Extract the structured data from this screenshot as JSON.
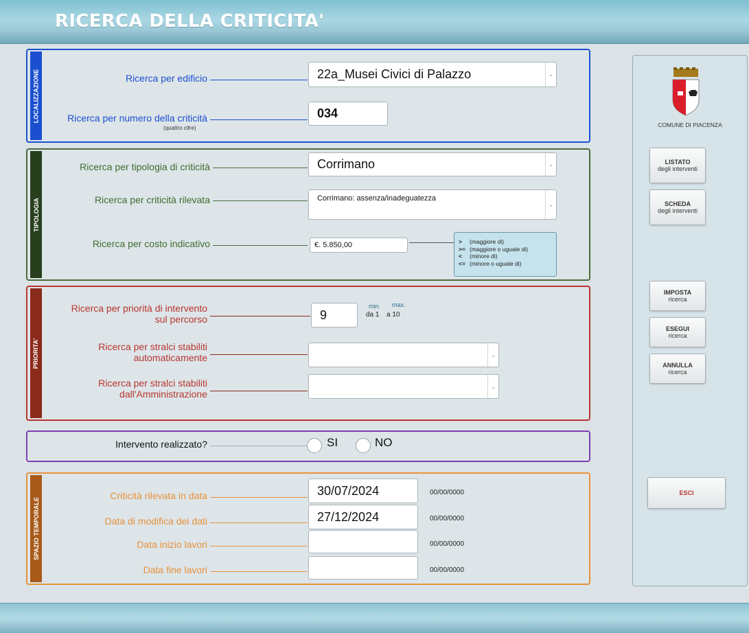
{
  "header": {
    "title": "RICERCA DELLA  CRITICITA'"
  },
  "colors": {
    "localizzazione": "#1b4fcf",
    "tipologia": "#4c6b3c",
    "priorita": "#b8352d",
    "intervento": "#7e3fb2",
    "spazio": "#e8913a"
  },
  "localizzazione": {
    "tab": "LOCALIZZAZIONE",
    "edificio_label": "Ricerca per edificio",
    "edificio_value": "22a_Musei Civici di Palazzo",
    "numero_label": "Ricerca per numero della criticità",
    "numero_sublabel": "(quattro cifre)",
    "numero_value": "034"
  },
  "tipologia": {
    "tab": "TIPOLOGIA",
    "tipologia_label": "Ricerca per tipologia di criticità",
    "tipologia_value": "Corrimano",
    "rilevata_label": "Ricerca per criticità rilevata",
    "rilevata_value": "Corrimano: assenza/inadeguatezza",
    "costo_label": "Ricerca per costo indicativo",
    "costo_value": "€.  5.850,00",
    "operators": [
      {
        "op": ">",
        "desc": "(maggiore di)"
      },
      {
        "op": ">=",
        "desc": "(maggiore o uguale di)"
      },
      {
        "op": "<",
        "desc": "(minore di)"
      },
      {
        "op": "<=",
        "desc": "(minore o uguale di)"
      }
    ]
  },
  "priorita": {
    "tab": "PRIORITA'",
    "intervento_label_1": "Ricerca per priorità di intervento",
    "intervento_label_2": "sul percorso",
    "intervento_value": "9",
    "min_label": "min.",
    "max_label": "max.",
    "range_from": "da 1",
    "range_to": "a 10",
    "auto_label_1": "Ricerca per stralci stabiliti",
    "auto_label_2": "automaticamente",
    "amm_label_1": "Ricerca per stralci stabiliti",
    "amm_label_2": "dall'Amministrazione"
  },
  "intervento": {
    "question": "Intervento realizzato?",
    "si": "SI",
    "no": "NO"
  },
  "spazio": {
    "tab": "SPAZIO TEMPORALE",
    "rilevata_label": "Criticità rilevata in data",
    "rilevata_value": "30/07/2024",
    "modifica_label": "Data di modifica dei dati",
    "modifica_value": "27/12/2024",
    "inizio_label": "Data inizio lavori",
    "inizio_value": "",
    "fine_label": "Data fine lavori",
    "fine_value": "",
    "format_hint": "00/00/0000"
  },
  "sidebar": {
    "comune": "COMUNE DI PIACENZA",
    "listato": {
      "title": "LISTATO",
      "sub": "degli interventi"
    },
    "scheda": {
      "title": "SCHEDA",
      "sub": "degli interventi"
    },
    "imposta": {
      "title": "IMPOSTA",
      "sub": "ricerca"
    },
    "esegui": {
      "title": "ESEGUI",
      "sub": "ricerca"
    },
    "annulla": {
      "title": "ANNULLA",
      "sub": "ricerca"
    },
    "esci": "ESCI"
  }
}
